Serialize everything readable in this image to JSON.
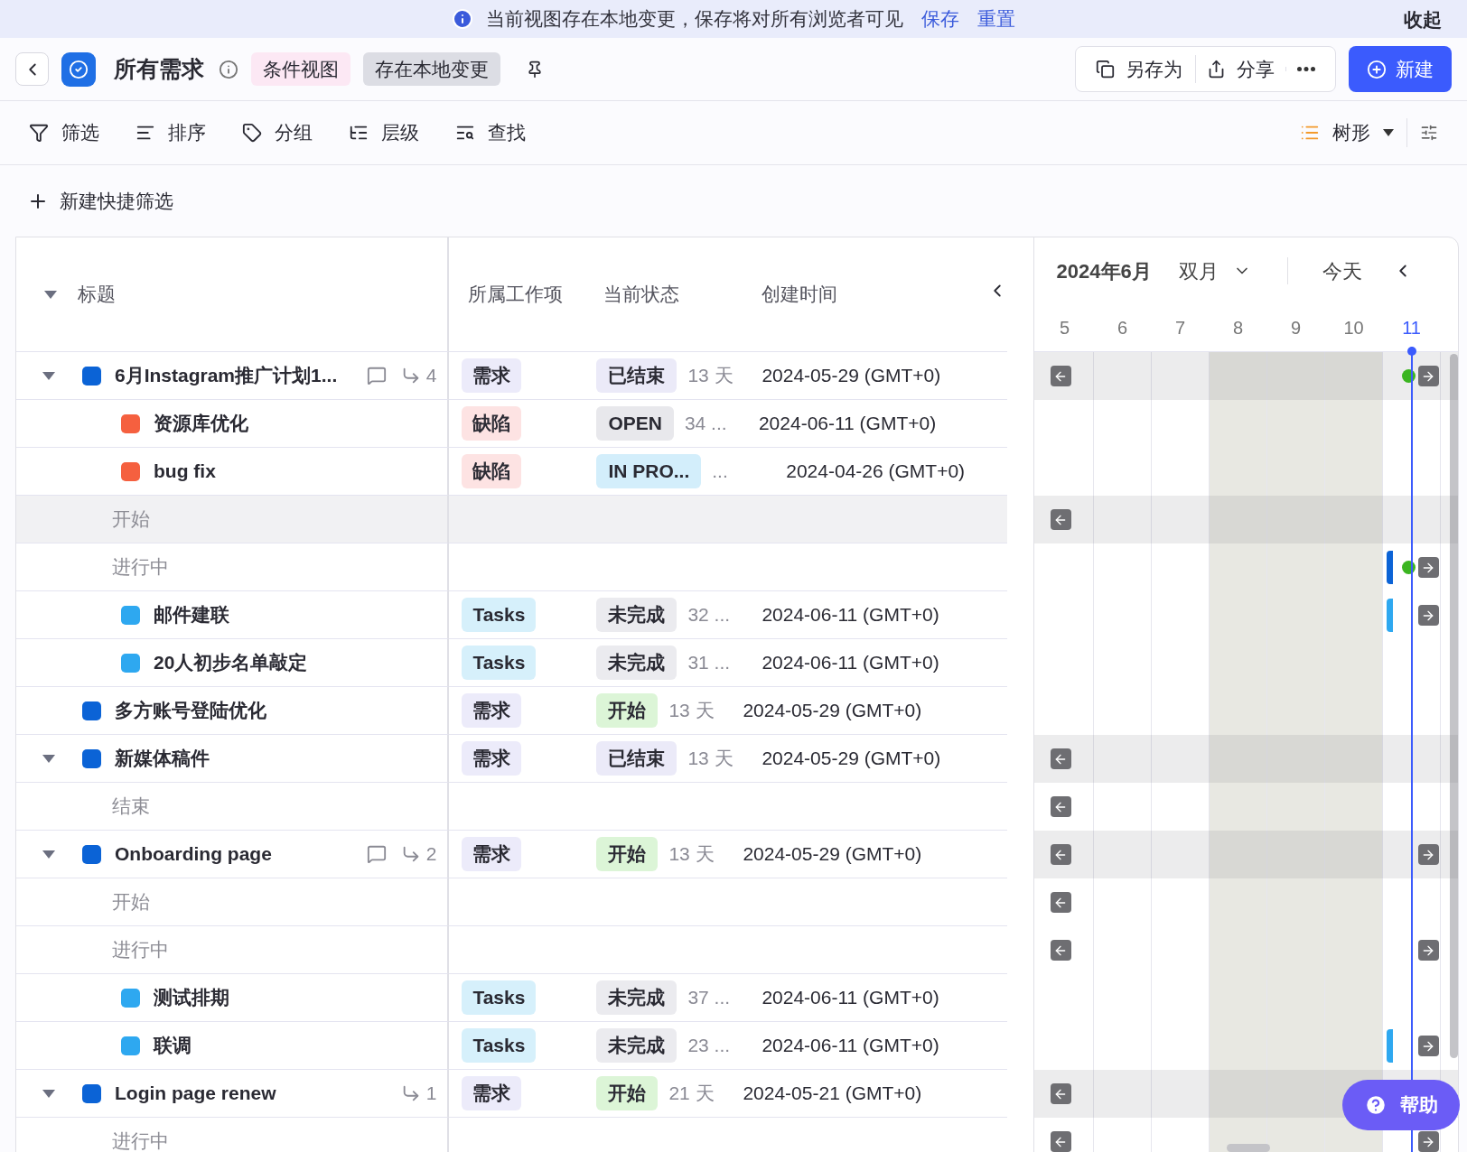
{
  "banner": {
    "message": "当前视图存在本地变更，保存将对所有浏览者可见",
    "links": [
      "保存",
      "重置"
    ],
    "collapse": "收起"
  },
  "header": {
    "title": "所有需求",
    "tags": [
      {
        "label": "条件视图",
        "color": "#fce8f4"
      },
      {
        "label": "存在本地变更",
        "color": "#dcdde4"
      }
    ],
    "actions": [
      {
        "kind": "save_as",
        "label": "另存为"
      },
      {
        "kind": "share",
        "label": "分享"
      }
    ],
    "new_button": "新建"
  },
  "toolbar": {
    "tools": [
      {
        "kind": "filter",
        "label": "筛选"
      },
      {
        "kind": "sort",
        "label": "排序"
      },
      {
        "kind": "group",
        "label": "分组"
      },
      {
        "kind": "level",
        "label": "层级"
      },
      {
        "kind": "find",
        "label": "查找"
      }
    ],
    "view": "树形"
  },
  "quick_filter": "新建快捷筛选",
  "table": {
    "columns": [
      "标题",
      "所属工作项",
      "当前状态",
      "创建时间"
    ],
    "rows": [
      {
        "kind": "item",
        "title": "6月Instagram推广计划1...",
        "color": "#0b63d6",
        "expanded": true,
        "comments": true,
        "subtasks": "4",
        "type": {
          "label": "需求",
          "color": "#ecebfa"
        },
        "status": {
          "label": "已结束",
          "color": "#ebeaf8"
        },
        "duration": "13 天",
        "created": "2024-05-29 (GMT+0)",
        "gantt": {
          "before": true,
          "after": true,
          "dot": true
        },
        "children": [
          {
            "kind": "item",
            "title": "资源库优化",
            "color": "#f5603f",
            "comments": false,
            "type": {
              "label": "缺陷",
              "color": "#fde3e3"
            },
            "status": {
              "label": "OPEN",
              "color": "#e8e8ec"
            },
            "duration": "34 ...",
            "created": "2024-06-11 (GMT+0)",
            "gantt": {
              "before": false,
              "after": false
            }
          },
          {
            "kind": "item",
            "title": "bug fix",
            "color": "#f5603f",
            "comments": false,
            "type": {
              "label": "缺陷",
              "color": "#fde3e3"
            },
            "status": {
              "label": "IN PRO...",
              "color": "#d3eefb"
            },
            "duration": "...",
            "created": "2024-04-26 (GMT+0)",
            "gantt": {
              "before": false,
              "after": false
            }
          },
          {
            "kind": "group",
            "title": "开始",
            "highlighted": true,
            "gantt": {
              "before": true,
              "after": false
            }
          },
          {
            "kind": "group",
            "title": "进行中",
            "highlighted": false,
            "gantt": {
              "before": false,
              "after": true,
              "dot": true,
              "bar": {
                "color": "#0b63d6"
              }
            },
            "children": [
              {
                "kind": "item",
                "title": "邮件建联",
                "color": "#2ea8f0",
                "comments": false,
                "type": {
                  "label": "Tasks",
                  "color": "#d6f0fb"
                },
                "status": {
                  "label": "未完成",
                  "color": "#ebebef"
                },
                "duration": "32 ...",
                "created": "2024-06-11 (GMT+0)",
                "gantt": {
                  "before": false,
                  "after": true,
                  "bar": {
                    "color": "#2ea8f0"
                  }
                }
              },
              {
                "kind": "item",
                "title": "20人初步名单敲定",
                "color": "#2ea8f0",
                "comments": false,
                "type": {
                  "label": "Tasks",
                  "color": "#d6f0fb"
                },
                "status": {
                  "label": "未完成",
                  "color": "#ebebef"
                },
                "duration": "31 ...",
                "created": "2024-06-11 (GMT+0)",
                "gantt": {
                  "before": false,
                  "after": false
                }
              }
            ]
          }
        ]
      },
      {
        "kind": "item",
        "title": "多方账号登陆优化",
        "color": "#0b63d6",
        "comments": false,
        "type": {
          "label": "需求",
          "color": "#ecebfa"
        },
        "status": {
          "label": "开始",
          "color": "#dcf5d7"
        },
        "duration": "13 天",
        "created": "2024-05-29 (GMT+0)",
        "gantt": {
          "before": false,
          "after": false
        }
      },
      {
        "kind": "item",
        "title": "新媒体稿件",
        "color": "#0b63d6",
        "expanded": true,
        "comments": false,
        "type": {
          "label": "需求",
          "color": "#ecebfa"
        },
        "status": {
          "label": "已结束",
          "color": "#ebeaf8"
        },
        "duration": "13 天",
        "created": "2024-05-29 (GMT+0)",
        "gantt": {
          "before": true,
          "after": false
        },
        "children": [
          {
            "kind": "group",
            "title": "结束",
            "highlighted": false,
            "gantt": {
              "before": true,
              "after": false
            }
          }
        ]
      },
      {
        "kind": "item",
        "title": "Onboarding page",
        "color": "#0b63d6",
        "expanded": true,
        "comments": true,
        "subtasks": "2",
        "type": {
          "label": "需求",
          "color": "#ecebfa"
        },
        "status": {
          "label": "开始",
          "color": "#dcf5d7"
        },
        "duration": "13 天",
        "created": "2024-05-29 (GMT+0)",
        "gantt": {
          "before": true,
          "after": true
        },
        "children": [
          {
            "kind": "group",
            "title": "开始",
            "highlighted": false,
            "gantt": {
              "before": true,
              "after": false
            }
          },
          {
            "kind": "group",
            "title": "进行中",
            "highlighted": false,
            "gantt": {
              "before": true,
              "after": true
            },
            "children": [
              {
                "kind": "item",
                "title": "测试排期",
                "color": "#2ea8f0",
                "comments": false,
                "type": {
                  "label": "Tasks",
                  "color": "#d6f0fb"
                },
                "status": {
                  "label": "未完成",
                  "color": "#ebebef"
                },
                "duration": "37 ...",
                "created": "2024-06-11 (GMT+0)",
                "gantt": {
                  "before": false,
                  "after": false
                }
              },
              {
                "kind": "item",
                "title": "联调",
                "color": "#2ea8f0",
                "comments": false,
                "type": {
                  "label": "Tasks",
                  "color": "#d6f0fb"
                },
                "status": {
                  "label": "未完成",
                  "color": "#ebebef"
                },
                "duration": "23 ...",
                "created": "2024-06-11 (GMT+0)",
                "gantt": {
                  "before": false,
                  "after": true,
                  "bar": {
                    "color": "#2ea8f0"
                  }
                }
              }
            ]
          }
        ]
      },
      {
        "kind": "item",
        "title": "Login page renew",
        "color": "#0b63d6",
        "expanded": true,
        "comments": false,
        "subtasks": "1",
        "type": {
          "label": "需求",
          "color": "#ecebfa"
        },
        "status": {
          "label": "开始",
          "color": "#dcf5d7"
        },
        "duration": "21 天",
        "created": "2024-05-21 (GMT+0)",
        "gantt": {
          "before": true,
          "after": false
        },
        "children": [
          {
            "kind": "group",
            "title": "进行中",
            "highlighted": false,
            "gantt": {
              "before": true,
              "after": true
            }
          }
        ]
      }
    ]
  },
  "gantt": {
    "month": "2024年6月",
    "range": "双月",
    "today": "今天",
    "days": [
      {
        "label": "5",
        "weekend": false,
        "today": false
      },
      {
        "label": "6",
        "weekend": false,
        "today": false
      },
      {
        "label": "7",
        "weekend": false,
        "today": false
      },
      {
        "label": "8",
        "weekend": true,
        "today": false
      },
      {
        "label": "9",
        "weekend": true,
        "today": false
      },
      {
        "label": "10",
        "weekend": true,
        "today": false
      },
      {
        "label": "11",
        "weekend": false,
        "today": true
      }
    ]
  },
  "help": "帮助"
}
